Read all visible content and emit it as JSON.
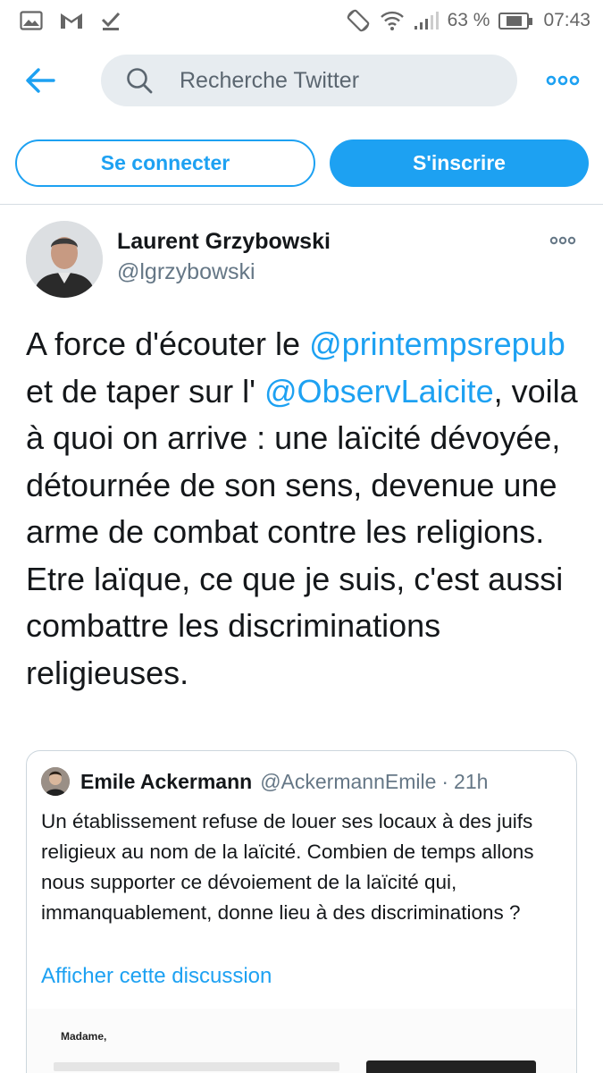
{
  "status_bar": {
    "battery": "63 %",
    "battery_level": 0.63,
    "time": "07:43",
    "icons_left": [
      "gallery-icon",
      "gmail-icon",
      "download-done-icon"
    ],
    "icons_right": [
      "rotate-icon",
      "wifi-icon",
      "signal-icon",
      "battery-icon"
    ]
  },
  "topbar": {
    "search_placeholder": "Recherche Twitter"
  },
  "auth": {
    "login_label": "Se connecter",
    "signup_label": "S'inscrire"
  },
  "tweet": {
    "author_name": "Laurent Grzybowski",
    "author_handle": "@lgrzybowski",
    "text_parts": {
      "p1": "A force d'écouter le ",
      "mention1": "@printempsrepub",
      "p2": " et de taper sur l' ",
      "mention2": "@ObservLaicite",
      "p3": ", voila à quoi on arrive : une laïcité dévoyée, détournée de son sens, devenue une arme de combat contre les religions. Etre laïque, ce que je suis, c'est aussi combattre les discriminations religieuses."
    }
  },
  "quoted": {
    "author_name": "Emile Ackermann",
    "author_handle": "@AckermannEmile",
    "separator": "·",
    "time": "21h",
    "text": "Un établissement refuse de louer ses locaux à des juifs religieux au nom de la  laïcité. Combien de temps allons nous supporter ce dévoiement de la laïcité qui, immanquablement, donne lieu à des discriminations ?",
    "show_thread": "Afficher cette discussion",
    "image_text": "Madame,"
  },
  "colors": {
    "accent": "#1da1f2",
    "text": "#14171a",
    "secondary": "#657786",
    "search_bg": "#e7ecf0",
    "border": "#ccd6dd"
  }
}
